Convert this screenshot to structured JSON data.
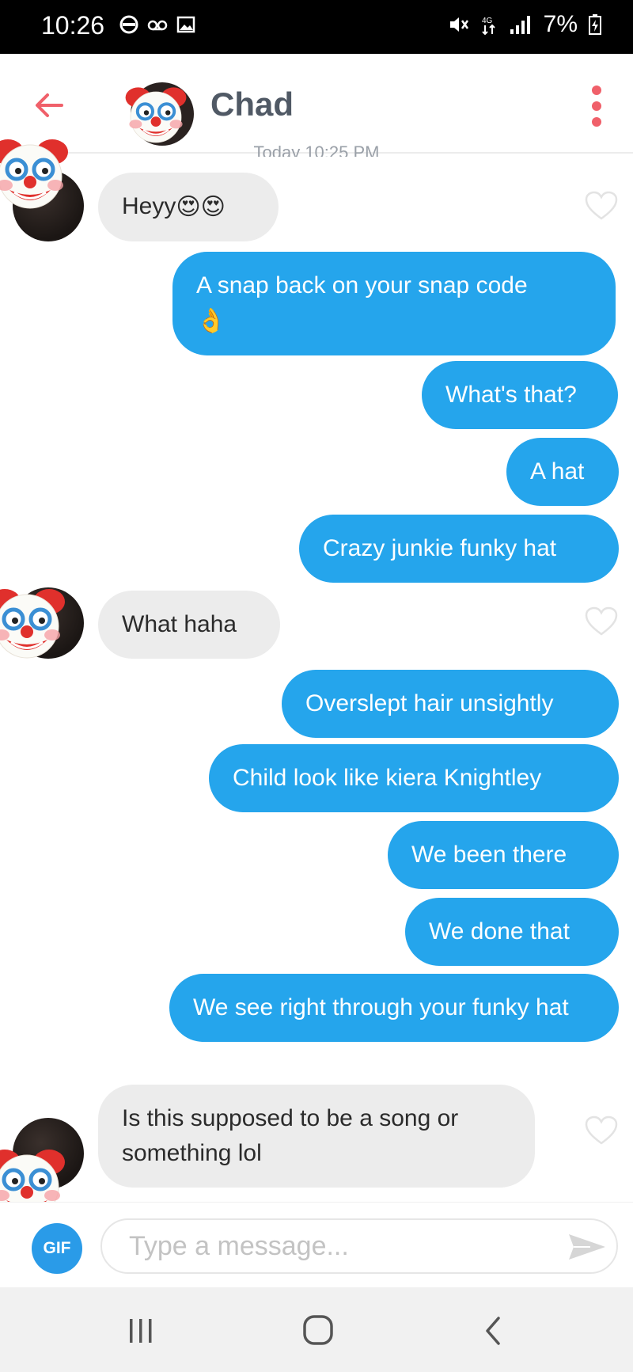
{
  "status_bar": {
    "time": "10:26",
    "battery": "7%"
  },
  "header": {
    "contact_name": "Chad",
    "timestamp": "Today 10:25 PM"
  },
  "messages": [
    {
      "side": "received",
      "text": "Heyy",
      "emoji": "😍😍"
    },
    {
      "side": "sent",
      "text": "A snap back on your snap code",
      "emoji": "👌"
    },
    {
      "side": "sent",
      "text": "What's that?"
    },
    {
      "side": "sent",
      "text": "A hat"
    },
    {
      "side": "sent",
      "text": "Crazy junkie funky hat"
    },
    {
      "side": "received",
      "text": "What haha"
    },
    {
      "side": "sent",
      "text": "Overslept hair unsightly"
    },
    {
      "side": "sent",
      "text": "Child look like kiera Knightley"
    },
    {
      "side": "sent",
      "text": "We been there"
    },
    {
      "side": "sent",
      "text": "We done that"
    },
    {
      "side": "sent",
      "text": "We see right through your funky hat"
    },
    {
      "side": "received",
      "text": "Is this supposed to be a song or something lol"
    }
  ],
  "composer": {
    "gif_label": "GIF",
    "placeholder": "Type a message..."
  },
  "colors": {
    "sent_bubble": "#25a5ec",
    "received_bubble": "#ececec",
    "back_arrow": "#f0606a",
    "menu_dots": "#f0606a",
    "gif_button": "#2a9be8"
  },
  "icons": [
    "back-arrow-icon",
    "more-options-icon",
    "heart-icon",
    "send-icon",
    "clown-face-icon",
    "recents-icon",
    "home-icon",
    "nav-back-icon"
  ]
}
